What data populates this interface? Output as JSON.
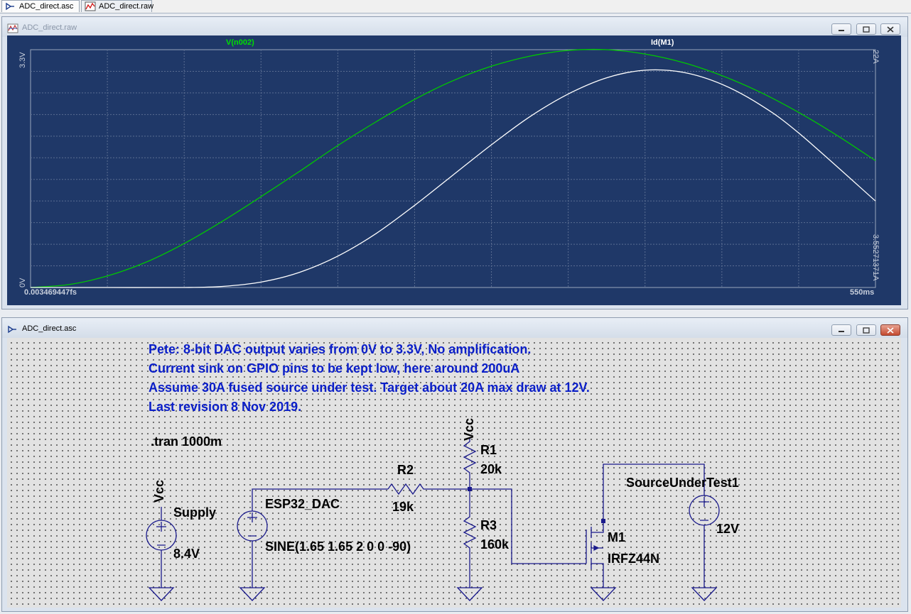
{
  "tabs": [
    {
      "label": "ADC_direct.asc",
      "icon": "schematic-icon",
      "active": true
    },
    {
      "label": "ADC_direct.raw",
      "icon": "waveform-icon",
      "active": false
    }
  ],
  "waveform_window": {
    "title": "ADC_direct.raw",
    "traces": [
      {
        "name": "V(n002)",
        "color": "#00c800"
      },
      {
        "name": "Id(M1)",
        "color": "#ffffff"
      }
    ],
    "left_axis": {
      "top": "3.3V",
      "bottom": "0V"
    },
    "right_axis": {
      "top": "22A",
      "bottom": "3.55271371A"
    },
    "x_axis": {
      "start": "0.003469447fs",
      "end": "550ms"
    }
  },
  "chart_data": {
    "type": "line",
    "xlabel": "",
    "xlim": [
      0,
      550
    ],
    "x_unit": "ms",
    "ylim_left": [
      0,
      3.3
    ],
    "ylim_right": [
      0,
      22
    ],
    "grid": true,
    "series": [
      {
        "name": "V(n002)",
        "axis": "left",
        "color": "#00c800",
        "x": [
          0,
          25,
          50,
          75,
          100,
          125,
          150,
          175,
          200,
          225,
          250,
          275,
          300,
          325,
          350,
          375,
          400,
          425,
          450,
          475,
          500,
          525,
          550
        ],
        "values": [
          0.0,
          0.04,
          0.16,
          0.35,
          0.61,
          0.92,
          1.26,
          1.61,
          1.97,
          2.3,
          2.61,
          2.87,
          3.07,
          3.21,
          3.29,
          3.3,
          3.24,
          3.12,
          2.94,
          2.71,
          2.43,
          2.11,
          1.76
        ]
      },
      {
        "name": "Id(M1)",
        "axis": "right",
        "color": "#ffffff",
        "x": [
          0,
          50,
          100,
          125,
          150,
          175,
          200,
          225,
          250,
          275,
          300,
          325,
          350,
          375,
          400,
          425,
          450,
          475,
          500,
          550
        ],
        "values": [
          0.0,
          0.0,
          0.0,
          0.1,
          0.5,
          1.4,
          2.9,
          5.0,
          7.6,
          10.4,
          13.2,
          15.8,
          17.9,
          19.4,
          20.1,
          19.9,
          18.8,
          16.9,
          14.3,
          8.0
        ]
      }
    ]
  },
  "schematic_window": {
    "title": "ADC_direct.asc",
    "notes": [
      "Pete:  8-bit DAC output varies from 0V to 3.3V,  No amplification.",
      "Current sink on GPIO pins to be kept low, here around 200uA",
      "Assume 30A fused source under test.  Target about 20A max draw at 12V.",
      "Last revision 8 Nov 2019."
    ],
    "directive": ".tran 1000m",
    "components": {
      "supply": {
        "netlabel": "Vcc",
        "name": "Supply",
        "value": "8.4V"
      },
      "esp32": {
        "name": "ESP32_DAC",
        "value": "SINE(1.65 1.65 2 0 0 -90)"
      },
      "r1": {
        "netlabel": "Vcc",
        "name": "R1",
        "value": "20k"
      },
      "r2": {
        "name": "R2",
        "value": "19k"
      },
      "r3": {
        "name": "R3",
        "value": "160k"
      },
      "m1": {
        "name": "M1",
        "value": "IRFZ44N"
      },
      "source": {
        "name": "SourceUnderTest1",
        "value": "12V"
      }
    }
  }
}
